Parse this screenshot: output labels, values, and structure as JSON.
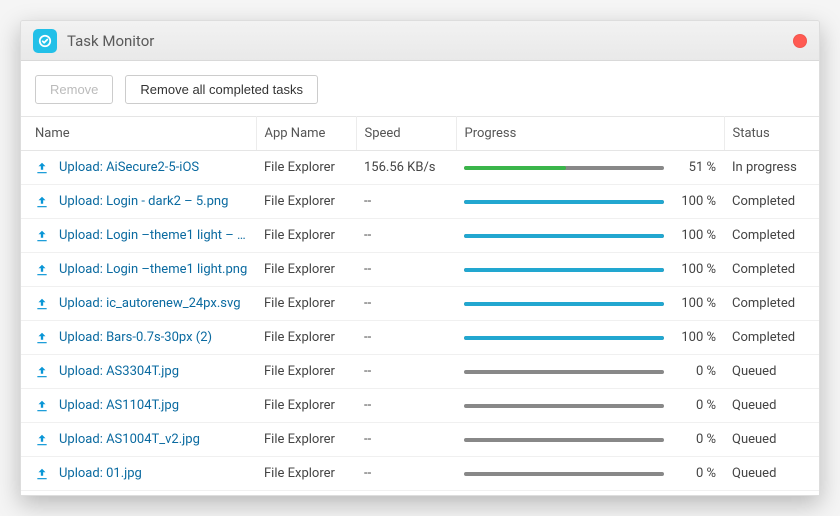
{
  "window": {
    "title": "Task Monitor"
  },
  "toolbar": {
    "remove_label": "Remove",
    "remove_all_label": "Remove all completed tasks"
  },
  "columns": {
    "name": "Name",
    "app": "App Name",
    "speed": "Speed",
    "progress": "Progress",
    "status": "Status"
  },
  "colors": {
    "accent": "#22c0e8",
    "progress_active": "#3ab54a",
    "progress_done": "#22a7d0",
    "close": "#ff5a52"
  },
  "tasks": [
    {
      "name": "Upload: AiSecure2-5-iOS",
      "app": "File Explorer",
      "speed": "156.56 KB/s",
      "pct": 51,
      "pct_label": "51 %",
      "status": "In progress",
      "bar": "green"
    },
    {
      "name": "Upload: Login - dark2 – 5.png",
      "app": "File Explorer",
      "speed": "--",
      "pct": 100,
      "pct_label": "100 %",
      "status": "Completed",
      "bar": "blue"
    },
    {
      "name": "Upload: Login –theme1 light – 1....",
      "app": "File Explorer",
      "speed": "--",
      "pct": 100,
      "pct_label": "100 %",
      "status": "Completed",
      "bar": "blue"
    },
    {
      "name": "Upload: Login –theme1 light.png",
      "app": "File Explorer",
      "speed": "--",
      "pct": 100,
      "pct_label": "100 %",
      "status": "Completed",
      "bar": "blue"
    },
    {
      "name": "Upload: ic_autorenew_24px.svg",
      "app": "File Explorer",
      "speed": "--",
      "pct": 100,
      "pct_label": "100 %",
      "status": "Completed",
      "bar": "blue"
    },
    {
      "name": "Upload: Bars-0.7s-30px (2)",
      "app": "File Explorer",
      "speed": "--",
      "pct": 100,
      "pct_label": "100 %",
      "status": "Completed",
      "bar": "blue"
    },
    {
      "name": "Upload: AS3304T.jpg",
      "app": "File Explorer",
      "speed": "--",
      "pct": 0,
      "pct_label": "0 %",
      "status": "Queued",
      "bar": "none"
    },
    {
      "name": "Upload: AS1104T.jpg",
      "app": "File Explorer",
      "speed": "--",
      "pct": 0,
      "pct_label": "0 %",
      "status": "Queued",
      "bar": "none"
    },
    {
      "name": "Upload: AS1004T_v2.jpg",
      "app": "File Explorer",
      "speed": "--",
      "pct": 0,
      "pct_label": "0 %",
      "status": "Queued",
      "bar": "none"
    },
    {
      "name": "Upload: 01.jpg",
      "app": "File Explorer",
      "speed": "--",
      "pct": 0,
      "pct_label": "0 %",
      "status": "Queued",
      "bar": "none"
    }
  ]
}
